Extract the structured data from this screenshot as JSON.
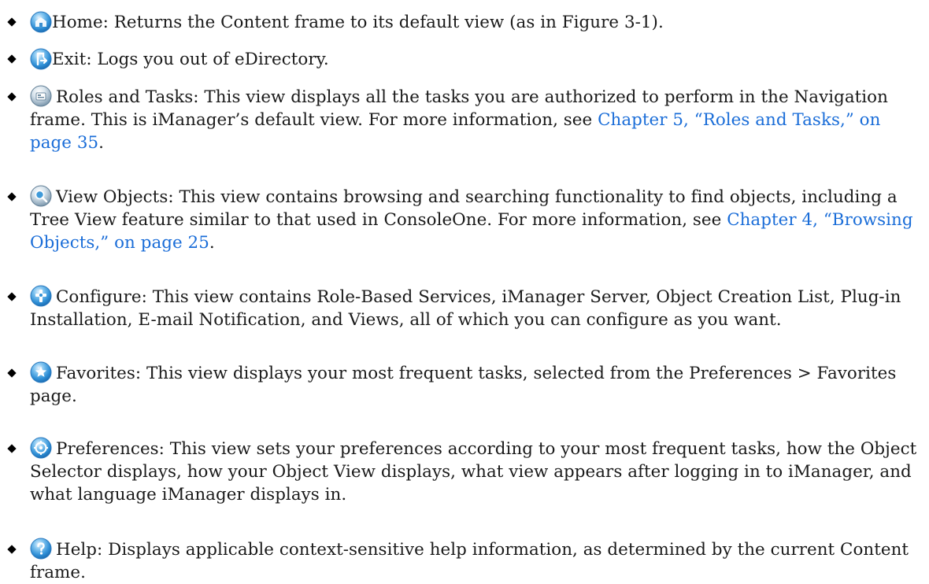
{
  "items": [
    {
      "icon": "home-icon",
      "text": "Home: Returns the Content frame to its default view (as in Figure 3-1)."
    },
    {
      "icon": "exit-icon",
      "text": "Exit: Logs you out of eDirectory."
    },
    {
      "icon": "roles-and-tasks-icon",
      "text": "Roles and Tasks: This view displays all the tasks you are authorized to perform in the Navigation frame. This is iManager’s default view. For more information, see ",
      "link": "Chapter 5, “Roles and Tasks,” on page 35",
      "after": "."
    },
    {
      "icon": "view-objects-icon",
      "text": "View Objects: This view contains browsing and searching functionality to find objects, including a Tree View feature similar to that used in ConsoleOne. For more information, see ",
      "link": "Chapter 4, “Browsing Objects,” on page 25",
      "after": "."
    },
    {
      "icon": "configure-icon",
      "text": "Configure: This view contains Role-Based Services, iManager Server, Object Creation List, Plug-in Installation, E-mail Notification, and Views, all of which you can configure as you want."
    },
    {
      "icon": "favorites-icon",
      "text": "Favorites: This view displays your most frequent tasks, selected from the Preferences > Favorites page."
    },
    {
      "icon": "preferences-icon",
      "text": "Preferences: This view sets your preferences according to your most frequent tasks, how the Object Selector displays, how your Object View displays, what view appears after logging in to iManager, and what language iManager displays in."
    },
    {
      "icon": "help-icon",
      "text": "Help: Displays applicable context-sensitive help information, as determined by the current Content frame."
    }
  ]
}
